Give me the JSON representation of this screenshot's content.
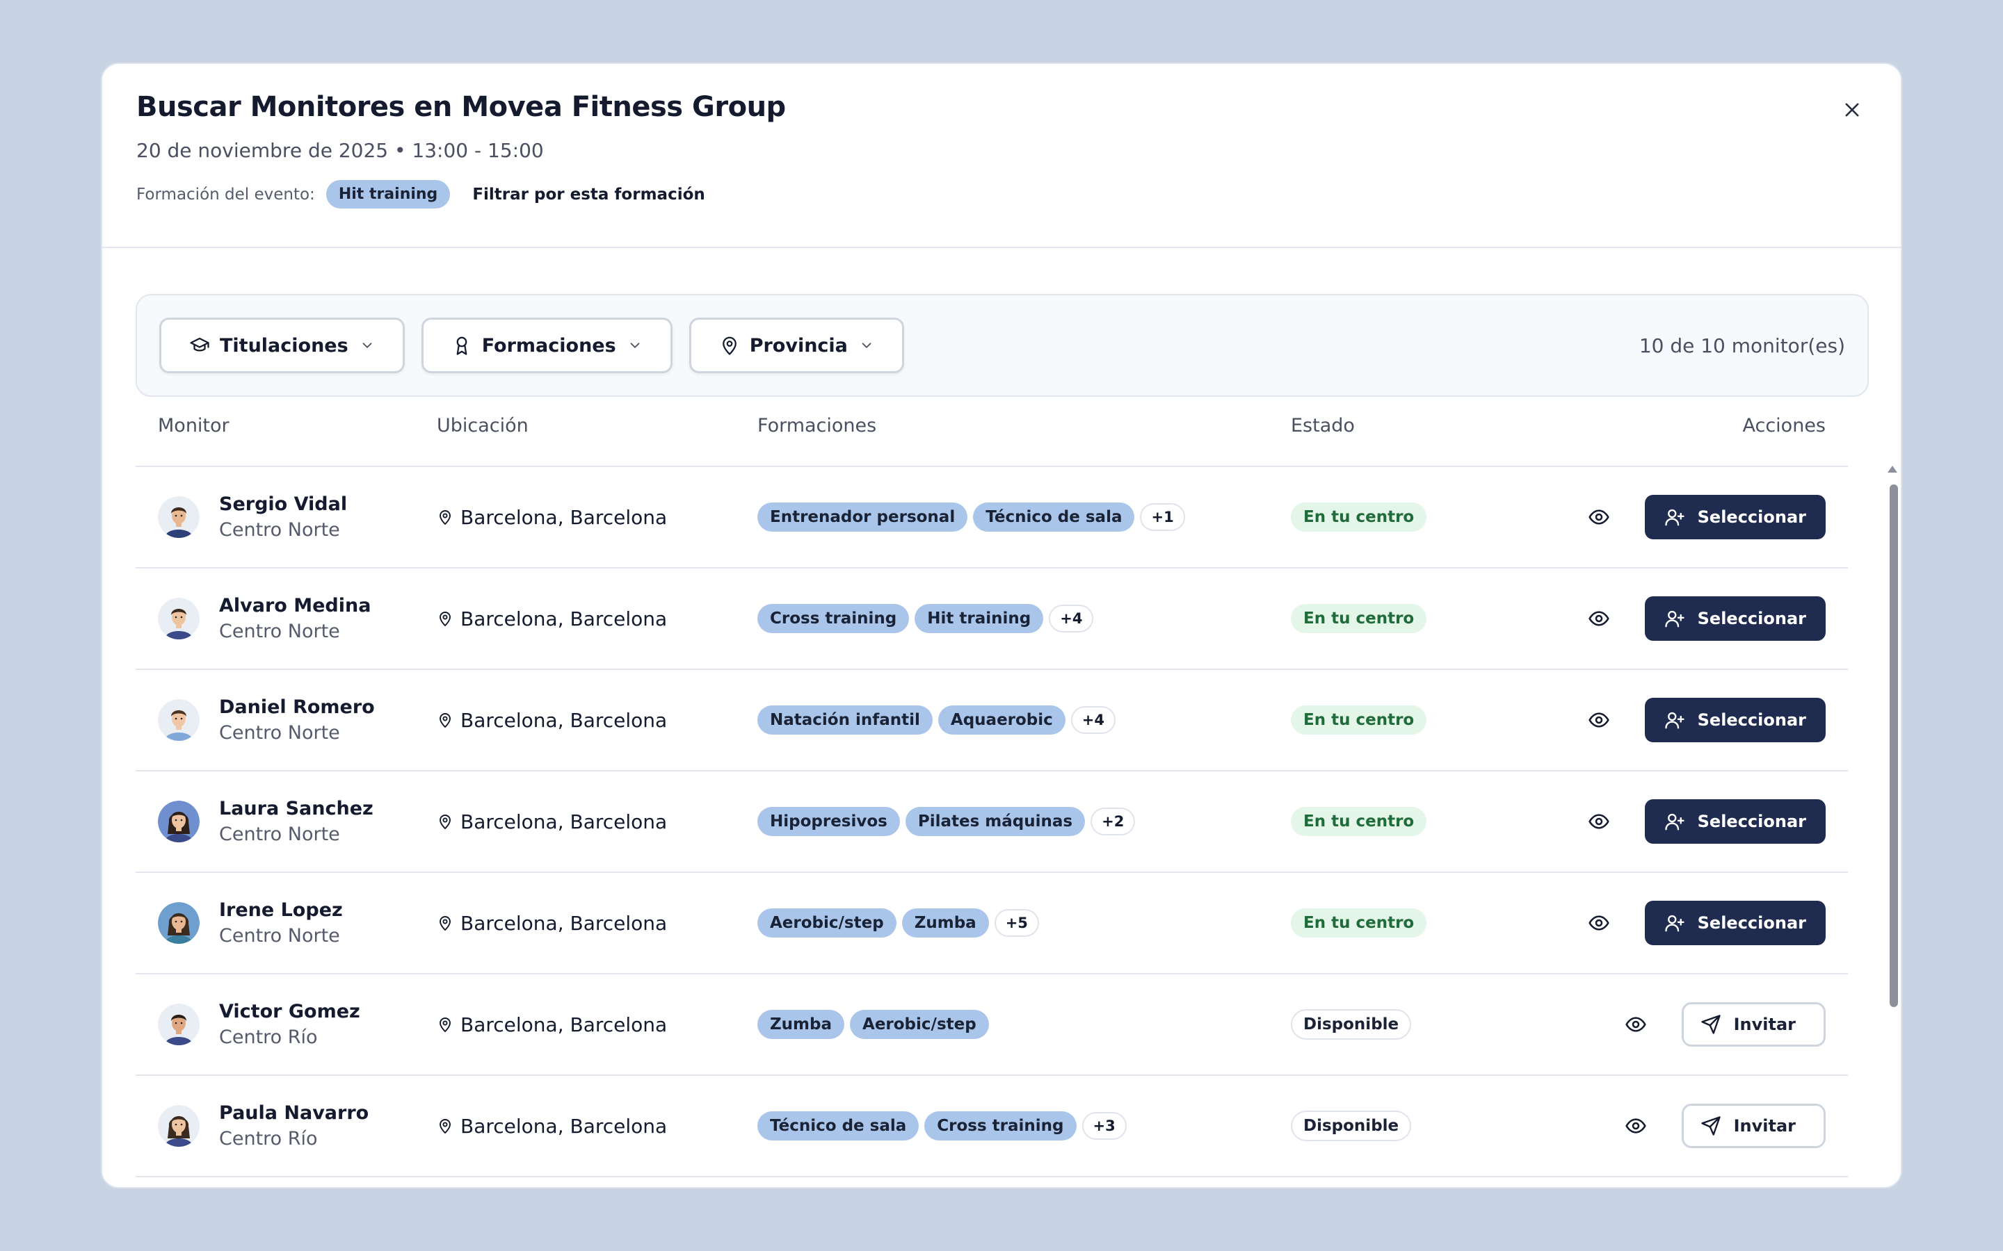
{
  "modal": {
    "title": "Buscar Monitores en Movea Fitness Group",
    "subtitle": "20 de noviembre de 2025 • 13:00 - 15:00",
    "formation_label": "Formación del evento:",
    "formation_chip": "Hit training",
    "filter_link": "Filtrar por esta formación"
  },
  "filters": {
    "titulaciones": "Titulaciones",
    "formaciones": "Formaciones",
    "provincia": "Provincia",
    "count": "10 de 10 monitor(es)"
  },
  "table": {
    "headers": {
      "monitor": "Monitor",
      "location": "Ubicación",
      "formations": "Formaciones",
      "state": "Estado",
      "actions": "Acciones"
    },
    "select_label": "Seleccionar",
    "invite_label": "Invitar",
    "rows": [
      {
        "name": "Sergio Vidal",
        "center": "Centro Norte",
        "location": "Barcelona, Barcelona",
        "tags": [
          "Entrenador personal",
          "Técnico de sala"
        ],
        "more": "+1",
        "state": "En tu centro",
        "state_type": "center",
        "action": "select",
        "avatar_skin": "#e8b892",
        "avatar_hair": "#3b2a20",
        "avatar_shirt": "#2e3f7a",
        "avatar_bg": "#e9eef5",
        "avatar_long_hair": false
      },
      {
        "name": "Alvaro Medina",
        "center": "Centro Norte",
        "location": "Barcelona, Barcelona",
        "tags": [
          "Cross training",
          "Hit training"
        ],
        "more": "+4",
        "state": "En tu centro",
        "state_type": "center",
        "action": "select",
        "avatar_skin": "#eec3a0",
        "avatar_hair": "#3a2a1e",
        "avatar_shirt": "#3a4a8a",
        "avatar_bg": "#e9eef5",
        "avatar_long_hair": false
      },
      {
        "name": "Daniel Romero",
        "center": "Centro Norte",
        "location": "Barcelona, Barcelona",
        "tags": [
          "Natación infantil",
          "Aquaerobic"
        ],
        "more": "+4",
        "state": "En tu centro",
        "state_type": "center",
        "action": "select",
        "avatar_skin": "#f0c6a4",
        "avatar_hair": "#4a3322",
        "avatar_shirt": "#7fa7d8",
        "avatar_bg": "#e9eef5",
        "avatar_long_hair": false
      },
      {
        "name": "Laura Sanchez",
        "center": "Centro Norte",
        "location": "Barcelona, Barcelona",
        "tags": [
          "Hipopresivos",
          "Pilates máquinas"
        ],
        "more": "+2",
        "state": "En tu centro",
        "state_type": "center",
        "action": "select",
        "avatar_skin": "#eec3a0",
        "avatar_hair": "#2e2018",
        "avatar_shirt": "#3a4a8a",
        "avatar_bg": "#6f8fcf",
        "avatar_long_hair": true
      },
      {
        "name": "Irene Lopez",
        "center": "Centro Norte",
        "location": "Barcelona, Barcelona",
        "tags": [
          "Aerobic/step",
          "Zumba"
        ],
        "more": "+5",
        "state": "En tu centro",
        "state_type": "center",
        "action": "select",
        "avatar_skin": "#e8b892",
        "avatar_hair": "#3b2a20",
        "avatar_shirt": "#3a7fa0",
        "avatar_bg": "#6f9fcf",
        "avatar_long_hair": true
      },
      {
        "name": "Victor Gomez",
        "center": "Centro Río",
        "location": "Barcelona, Barcelona",
        "tags": [
          "Zumba",
          "Aerobic/step"
        ],
        "more": "",
        "state": "Disponible",
        "state_type": "free",
        "action": "invite",
        "avatar_skin": "#e0a880",
        "avatar_hair": "#2a1d16",
        "avatar_shirt": "#3a4a8a",
        "avatar_bg": "#e9eef5",
        "avatar_long_hair": false
      },
      {
        "name": "Paula Navarro",
        "center": "Centro Río",
        "location": "Barcelona, Barcelona",
        "tags": [
          "Técnico de sala",
          "Cross training"
        ],
        "more": "+3",
        "state": "Disponible",
        "state_type": "free",
        "action": "invite",
        "avatar_skin": "#eec3a0",
        "avatar_hair": "#3b2a20",
        "avatar_shirt": "#3a4a8a",
        "avatar_bg": "#e9eef5",
        "avatar_long_hair": true
      }
    ]
  },
  "colors": {
    "backdrop": "#c8d4e4",
    "primary_button": "#1f2c4f",
    "tag": "#a9c6ea",
    "state_green_bg": "#e3f6e8",
    "state_green_text": "#1f6b3a"
  },
  "icons": {
    "close": "close-icon",
    "titulaciones": "graduation-cap-icon",
    "formaciones": "award-icon",
    "provincia": "map-pin-icon",
    "view": "eye-icon",
    "select": "user-plus-icon",
    "invite": "send-icon"
  }
}
